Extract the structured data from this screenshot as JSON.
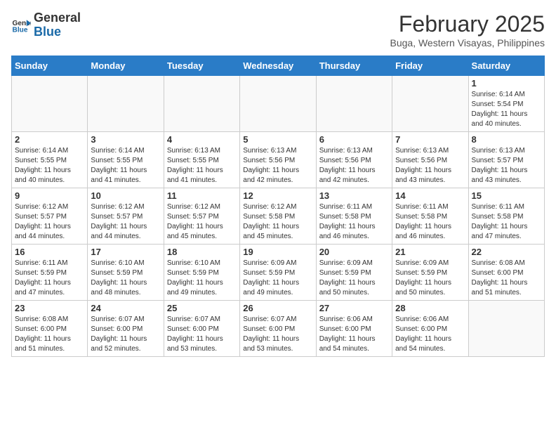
{
  "header": {
    "logo_general": "General",
    "logo_blue": "Blue",
    "month_year": "February 2025",
    "location": "Buga, Western Visayas, Philippines"
  },
  "weekdays": [
    "Sunday",
    "Monday",
    "Tuesday",
    "Wednesday",
    "Thursday",
    "Friday",
    "Saturday"
  ],
  "weeks": [
    [
      {
        "day": "",
        "info": ""
      },
      {
        "day": "",
        "info": ""
      },
      {
        "day": "",
        "info": ""
      },
      {
        "day": "",
        "info": ""
      },
      {
        "day": "",
        "info": ""
      },
      {
        "day": "",
        "info": ""
      },
      {
        "day": "1",
        "info": "Sunrise: 6:14 AM\nSunset: 5:54 PM\nDaylight: 11 hours\nand 40 minutes."
      }
    ],
    [
      {
        "day": "2",
        "info": "Sunrise: 6:14 AM\nSunset: 5:55 PM\nDaylight: 11 hours\nand 40 minutes."
      },
      {
        "day": "3",
        "info": "Sunrise: 6:14 AM\nSunset: 5:55 PM\nDaylight: 11 hours\nand 41 minutes."
      },
      {
        "day": "4",
        "info": "Sunrise: 6:13 AM\nSunset: 5:55 PM\nDaylight: 11 hours\nand 41 minutes."
      },
      {
        "day": "5",
        "info": "Sunrise: 6:13 AM\nSunset: 5:56 PM\nDaylight: 11 hours\nand 42 minutes."
      },
      {
        "day": "6",
        "info": "Sunrise: 6:13 AM\nSunset: 5:56 PM\nDaylight: 11 hours\nand 42 minutes."
      },
      {
        "day": "7",
        "info": "Sunrise: 6:13 AM\nSunset: 5:56 PM\nDaylight: 11 hours\nand 43 minutes."
      },
      {
        "day": "8",
        "info": "Sunrise: 6:13 AM\nSunset: 5:57 PM\nDaylight: 11 hours\nand 43 minutes."
      }
    ],
    [
      {
        "day": "9",
        "info": "Sunrise: 6:12 AM\nSunset: 5:57 PM\nDaylight: 11 hours\nand 44 minutes."
      },
      {
        "day": "10",
        "info": "Sunrise: 6:12 AM\nSunset: 5:57 PM\nDaylight: 11 hours\nand 44 minutes."
      },
      {
        "day": "11",
        "info": "Sunrise: 6:12 AM\nSunset: 5:57 PM\nDaylight: 11 hours\nand 45 minutes."
      },
      {
        "day": "12",
        "info": "Sunrise: 6:12 AM\nSunset: 5:58 PM\nDaylight: 11 hours\nand 45 minutes."
      },
      {
        "day": "13",
        "info": "Sunrise: 6:11 AM\nSunset: 5:58 PM\nDaylight: 11 hours\nand 46 minutes."
      },
      {
        "day": "14",
        "info": "Sunrise: 6:11 AM\nSunset: 5:58 PM\nDaylight: 11 hours\nand 46 minutes."
      },
      {
        "day": "15",
        "info": "Sunrise: 6:11 AM\nSunset: 5:58 PM\nDaylight: 11 hours\nand 47 minutes."
      }
    ],
    [
      {
        "day": "16",
        "info": "Sunrise: 6:11 AM\nSunset: 5:59 PM\nDaylight: 11 hours\nand 47 minutes."
      },
      {
        "day": "17",
        "info": "Sunrise: 6:10 AM\nSunset: 5:59 PM\nDaylight: 11 hours\nand 48 minutes."
      },
      {
        "day": "18",
        "info": "Sunrise: 6:10 AM\nSunset: 5:59 PM\nDaylight: 11 hours\nand 49 minutes."
      },
      {
        "day": "19",
        "info": "Sunrise: 6:09 AM\nSunset: 5:59 PM\nDaylight: 11 hours\nand 49 minutes."
      },
      {
        "day": "20",
        "info": "Sunrise: 6:09 AM\nSunset: 5:59 PM\nDaylight: 11 hours\nand 50 minutes."
      },
      {
        "day": "21",
        "info": "Sunrise: 6:09 AM\nSunset: 5:59 PM\nDaylight: 11 hours\nand 50 minutes."
      },
      {
        "day": "22",
        "info": "Sunrise: 6:08 AM\nSunset: 6:00 PM\nDaylight: 11 hours\nand 51 minutes."
      }
    ],
    [
      {
        "day": "23",
        "info": "Sunrise: 6:08 AM\nSunset: 6:00 PM\nDaylight: 11 hours\nand 51 minutes."
      },
      {
        "day": "24",
        "info": "Sunrise: 6:07 AM\nSunset: 6:00 PM\nDaylight: 11 hours\nand 52 minutes."
      },
      {
        "day": "25",
        "info": "Sunrise: 6:07 AM\nSunset: 6:00 PM\nDaylight: 11 hours\nand 53 minutes."
      },
      {
        "day": "26",
        "info": "Sunrise: 6:07 AM\nSunset: 6:00 PM\nDaylight: 11 hours\nand 53 minutes."
      },
      {
        "day": "27",
        "info": "Sunrise: 6:06 AM\nSunset: 6:00 PM\nDaylight: 11 hours\nand 54 minutes."
      },
      {
        "day": "28",
        "info": "Sunrise: 6:06 AM\nSunset: 6:00 PM\nDaylight: 11 hours\nand 54 minutes."
      },
      {
        "day": "",
        "info": ""
      }
    ]
  ]
}
